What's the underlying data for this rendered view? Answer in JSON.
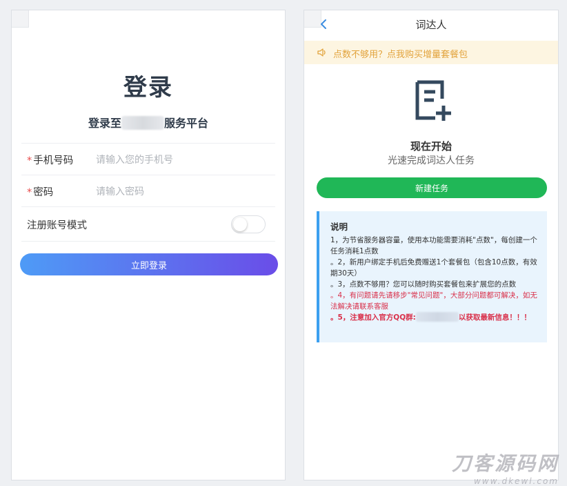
{
  "login": {
    "title": "登录",
    "subtitle_prefix": "登录至",
    "subtitle_suffix": "服务平台",
    "fields": [
      {
        "label": "手机号码",
        "required": "*",
        "placeholder": "请输入您的手机号"
      },
      {
        "label": "密码",
        "required": "*",
        "placeholder": "请输入密码"
      }
    ],
    "register_mode_label": "注册账号模式",
    "register_mode_on": false,
    "submit_label": "立即登录"
  },
  "task": {
    "nav_title": "词达人",
    "back_icon": "chevron-left-icon",
    "notice": "点数不够用？点我购买增量套餐包",
    "notice_icon": "speaker-icon",
    "start_title": "现在开始",
    "start_subtitle": "光速完成词达人任务",
    "new_task_label": "新建任务",
    "info": {
      "title": "说明",
      "lines": [
        "1，为节省服务器容量，使用本功能需要消耗\"点数\"，每创建一个任务消耗1点数",
        "。2，新用户绑定手机后免费赠送1个套餐包（包含10点数，有效期30天）",
        "。3，点数不够用？您可以随时购买套餐包来扩展您的点数",
        "。4，有问题请先请移步\"常见问题\"，大部分问题都可解决，如无法解决请联系客服"
      ],
      "line5_prefix": "。5，注意加入官方QQ群:",
      "line5_suffix": "以获取最新信息！！！"
    }
  },
  "watermark": {
    "big": "刀客源码网",
    "small": "www.dkewl.com"
  },
  "colors": {
    "login_gradient_start": "#4e9bf6",
    "login_gradient_end": "#6a4de8",
    "new_task_green": "#20b757",
    "notice_bg": "#fdf5e1",
    "notice_text": "#e2a33c",
    "info_bg": "#e9f4fd",
    "info_accent": "#3ca0f0",
    "info_red": "#d9304a",
    "required_red": "#e84a4a"
  }
}
